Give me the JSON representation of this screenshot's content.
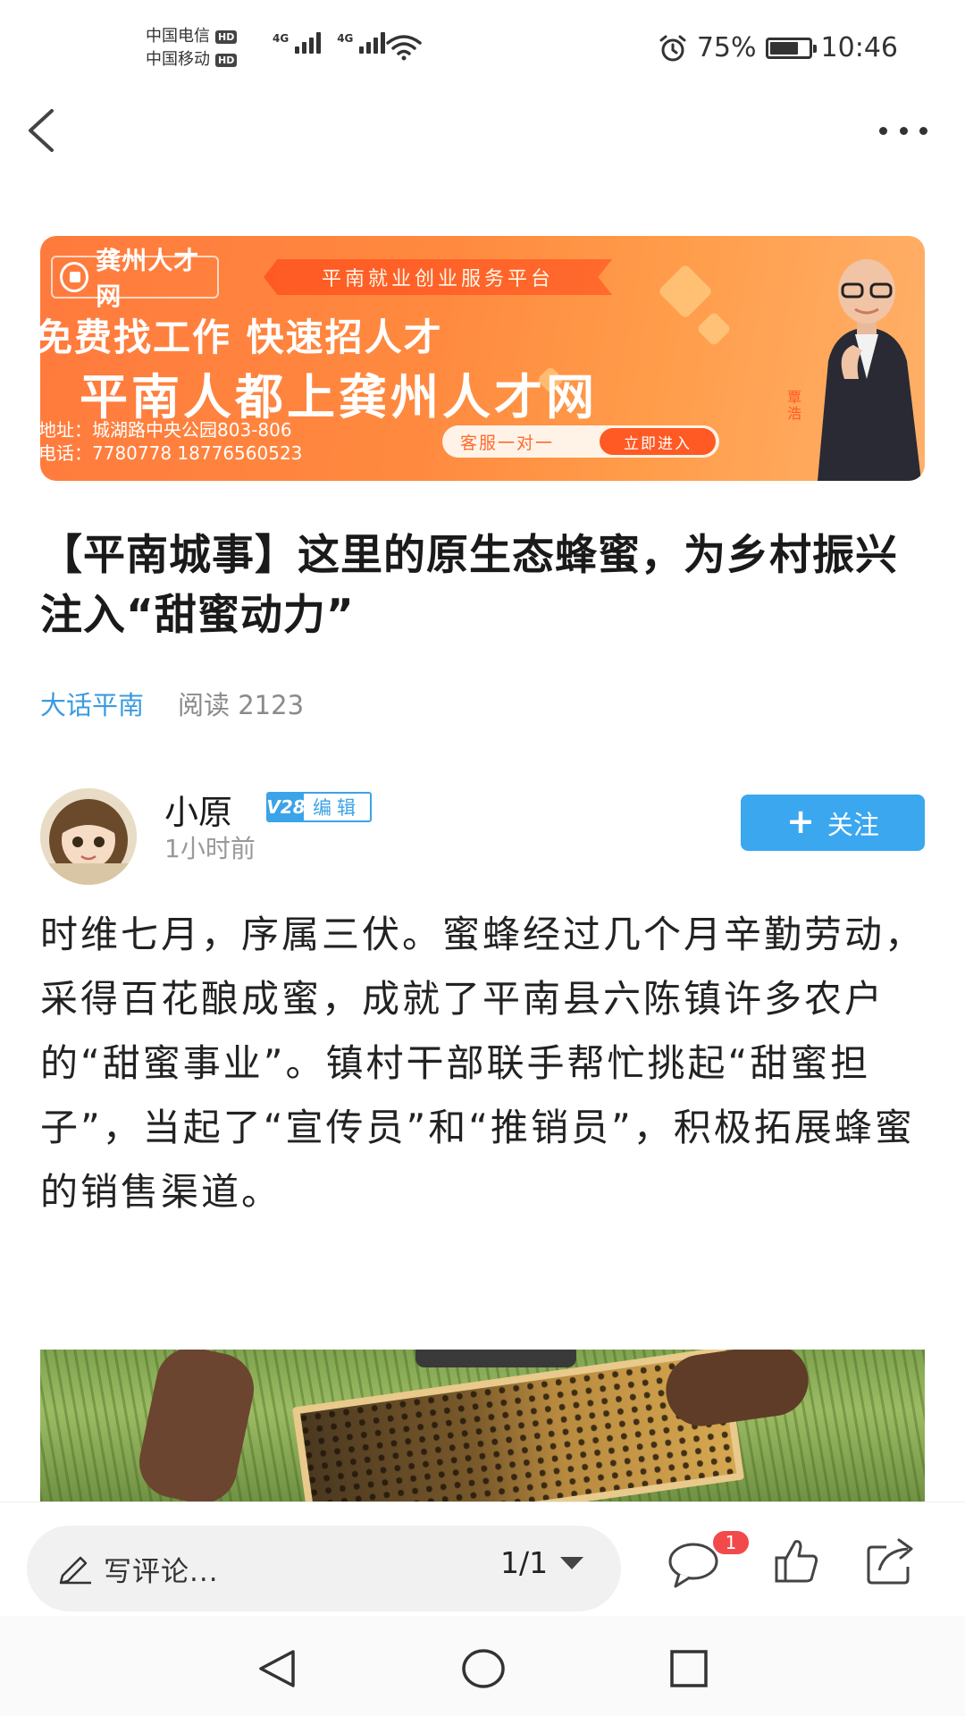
{
  "status_bar": {
    "carrier1": "中国电信",
    "carrier2": "中国移动",
    "hd": "HD",
    "network": "4G",
    "battery_percent": "75%",
    "battery_level": 0.75,
    "time": "10:46"
  },
  "banner": {
    "logo_text": "龚州人才网",
    "tag": "平南就业创业服务平台",
    "line1": "免费找工作 快速招人才",
    "line2": "平南人都上龚州人才网",
    "address": "地址：城湖路中央公园803-806",
    "phone": "电话：7780778  18776560523",
    "service": "客服一对一",
    "enter": "立即进入",
    "person_name": "覃浩"
  },
  "article": {
    "title": "【平南城事】这里的原生态蜂蜜，为乡村振兴注入“甜蜜动力”",
    "source": "大话平南",
    "reads": "阅读 2123",
    "body": "时维七月，序属三伏。蜜蜂经过几个月辛勤劳动，采得百花酿成蜜，成就了平南县六陈镇许多农户的“甜蜜事业”。镇村干部联手帮忙挑起“甜蜜担子”，当起了“宣传员”和“推销员”，积极拓展蜂蜜的销售渠道。"
  },
  "author": {
    "name": "小原",
    "level": "V28",
    "role": "编辑",
    "time": "1小时前",
    "follow_label": "关注"
  },
  "bottom_bar": {
    "comment_placeholder": "写评论...",
    "page_indicator": "1/1",
    "comment_count": "1"
  },
  "colors": {
    "accent": "#3aa7ef",
    "source_link": "#3b9be0",
    "banner_orange": "#ff7a3d",
    "badge_red": "#f24a4a"
  }
}
